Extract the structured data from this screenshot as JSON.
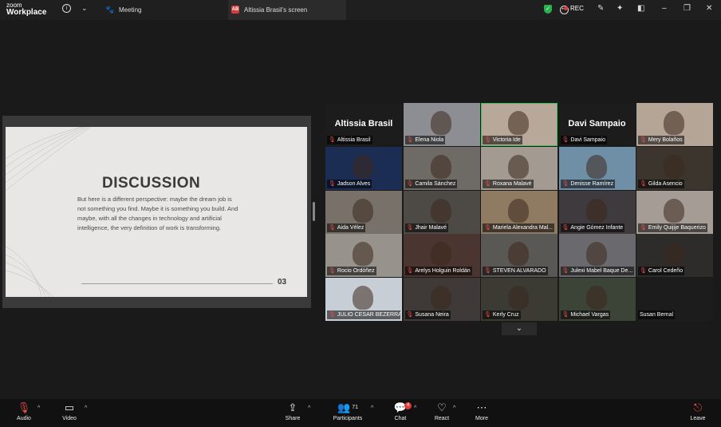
{
  "app": {
    "brand_line1": "zoom",
    "brand_line2": "Workplace"
  },
  "tabs": [
    {
      "label": "Meeting"
    },
    {
      "label": "Altissia Brasil's screen",
      "badge": "AB"
    }
  ],
  "top_right": {
    "rec_label": "REC",
    "accent": "#e53935",
    "secure_color": "#27b24a"
  },
  "slide": {
    "title": "DISCUSSION",
    "body": "But here is a different perspective: maybe the dream job is not something you find. Maybe it is something you build. And maybe, with all the changes in technology and artificial intelligence, the very definition of work is transforming.",
    "page_number": "03"
  },
  "participants": [
    {
      "name": "Altissia Brasil",
      "big_label": "Altissia Brasil",
      "bg": "#1c1c1c"
    },
    {
      "name": "Elena Niola",
      "bg": "#8c8e93"
    },
    {
      "name": "Victoria Ide",
      "bg": "#b8a89a",
      "active": true
    },
    {
      "name": "Davi Sampaio",
      "big_label": "Davi Sampaio",
      "bg": "#1c1c1c"
    },
    {
      "name": "Mery Bolaños",
      "bg": "#b5a597"
    },
    {
      "name": "Jadson Alves",
      "bg": "#1b2d52"
    },
    {
      "name": "Camila Sánchez",
      "bg": "#6e6a66"
    },
    {
      "name": "Roxana Malavé",
      "bg": "#a39a91"
    },
    {
      "name": "Denisse Ramírez",
      "bg": "#6f8fa6"
    },
    {
      "name": "Gilda Asencio",
      "bg": "#3b352d"
    },
    {
      "name": "Aida Vélez",
      "bg": "#77716a"
    },
    {
      "name": "Jhair Malavé",
      "bg": "#4d4a46"
    },
    {
      "name": "Mariela Alexandra Mal...",
      "bg": "#8e7b62"
    },
    {
      "name": "Angie Gómez Infante",
      "bg": "#3e3a3d"
    },
    {
      "name": "Emily Quijije Baquerizo",
      "bg": "#a59d95"
    },
    {
      "name": "Rocio Ordóñez",
      "bg": "#97928c"
    },
    {
      "name": "Arelys Holguin Roldán",
      "bg": "#4a3530"
    },
    {
      "name": "STEVEN ALVARADO",
      "bg": "#5a5855"
    },
    {
      "name": "Julexi Mabel Baque De...",
      "bg": "#6a6a6e"
    },
    {
      "name": "Carol Cedeño",
      "bg": "#2e2c2b"
    },
    {
      "name": "JULIO CESAR BEZERRA...",
      "bg": "#c8ced6"
    },
    {
      "name": "Susana Neira",
      "bg": "#3f3a38"
    },
    {
      "name": "Kerly Cruz",
      "bg": "#3b3a33"
    },
    {
      "name": "Michael Vargas",
      "bg": "#3c4438"
    },
    {
      "name": "Susan Bernal",
      "bg": "#1c1c1c",
      "no_mic": true
    }
  ],
  "toolbar": {
    "audio": "Audio",
    "video": "Video",
    "share": "Share",
    "participants": "Participants",
    "participants_count": "71",
    "chat": "Chat",
    "chat_badge": "4",
    "react": "React",
    "more": "More",
    "leave": "Leave"
  }
}
